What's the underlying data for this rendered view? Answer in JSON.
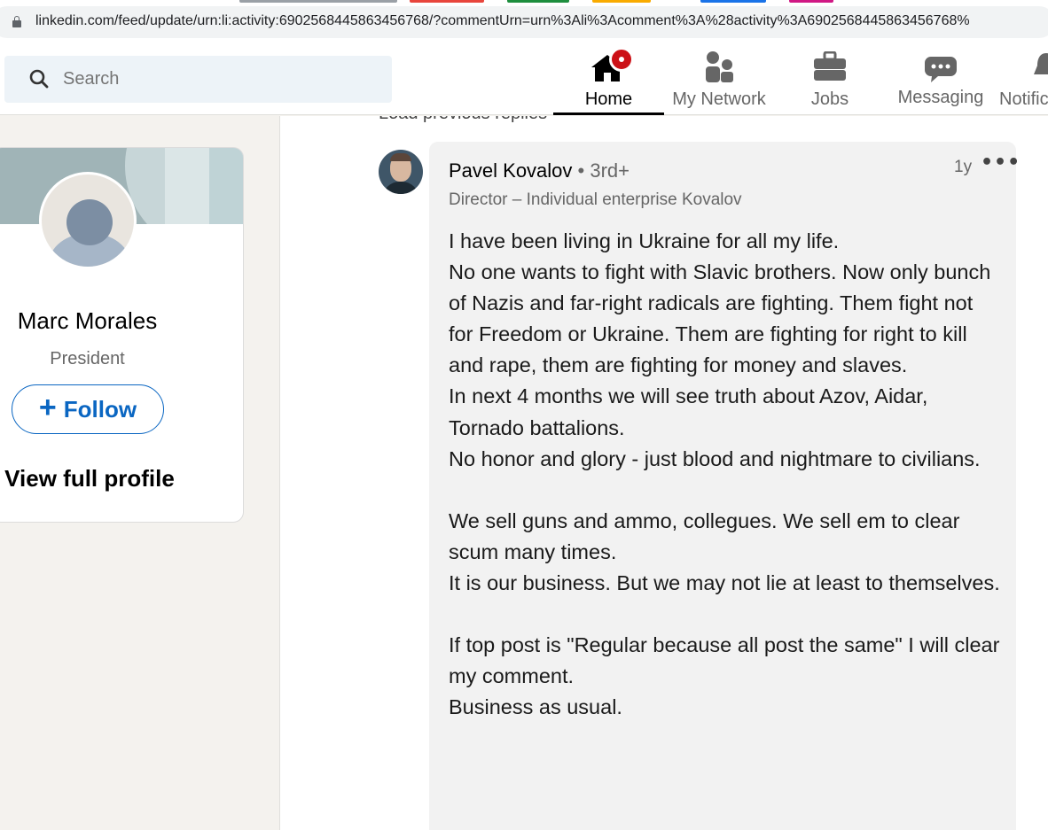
{
  "browser": {
    "url": "linkedin.com/feed/update/urn:li:activity:6902568445863456768/?commentUrn=urn%3Ali%3Acomment%3A%28activity%3A6902568445863456768%"
  },
  "header": {
    "search_placeholder": "Search",
    "nav": {
      "home": "Home",
      "network": "My Network",
      "jobs": "Jobs",
      "messaging": "Messaging",
      "notifications": "Notific"
    }
  },
  "profile_card": {
    "name": "Marc Morales",
    "title": "President",
    "follow_label": "Follow",
    "view_profile_label": "View full profile"
  },
  "comments": {
    "load_previous": "Load previous replies",
    "comment": {
      "author": "Pavel Kovalov",
      "degree": "• 3rd+",
      "headline": "Director – Individual enterprise Kovalov",
      "time": "1y",
      "more": "•••",
      "body": [
        "I have been living in Ukraine for all my life.",
        "No one wants to fight with Slavic brothers. Now only bunch of Nazis and far-right radicals are fighting. Them fight not for Freedom or Ukraine. Them are fighting for right to kill and rape, them are fighting for money and slaves.",
        "In next 4 months we will see truth about Azov, Aidar, Tornado battalions.",
        "No honor and glory - just blood and nightmare to civilians.",
        "",
        "We sell guns and ammo, collegues. We sell em to clear scum many times.",
        "It is our business. But we may not lie at least to themselves.",
        "",
        "If top post is \"Regular because all post the same\" I will clear my comment.",
        "Business as usual."
      ]
    }
  },
  "colors": {
    "linkedin_blue": "#0a66c2",
    "notification_red": "#cc1016",
    "bubble_bg": "#f2f2f2",
    "page_bg": "#f4f2ee"
  }
}
